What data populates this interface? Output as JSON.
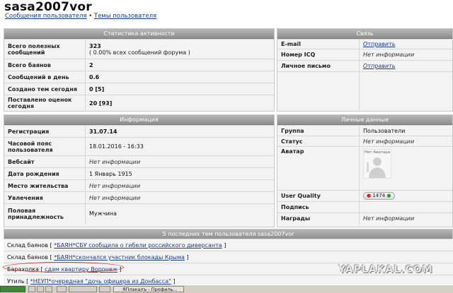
{
  "header": {
    "title": "sasa2007vor",
    "crumb1": "Сообщения пользователя",
    "crumb_sep": " • ",
    "crumb2": "Темы пользователя"
  },
  "stats": {
    "title": "Статистика активности",
    "rows": [
      {
        "k": "Всего полезных сообщений",
        "v": "323",
        "sub": "( 0.00% всех сообщений форума )"
      },
      {
        "k": "Всего баянов",
        "v": "2"
      },
      {
        "k": "Сообщений в день",
        "v": "0.6"
      },
      {
        "k": "Создано тем сегодня",
        "v": "0 [5]"
      },
      {
        "k": "Поставлено оценок сегодня",
        "v": "20 [93]"
      }
    ]
  },
  "contact": {
    "title": "Связь",
    "rows": [
      {
        "k": "E-mail",
        "v": "Отправить"
      },
      {
        "k": "Номер ICQ",
        "v": "Нет информации"
      },
      {
        "k": "Личное письмо",
        "v": "Отправить"
      }
    ]
  },
  "info": {
    "title": "Информация",
    "rows": [
      {
        "k": "Регистрация",
        "v": "31.07.14"
      },
      {
        "k": "Часовой пояс пользователя",
        "v": "18.01.2016 - 16:33"
      },
      {
        "k": "Вебсайт",
        "v": "Нет информации"
      },
      {
        "k": "Дата рождения",
        "v": "1 Январь 1915"
      },
      {
        "k": "Место жительства",
        "v": "Нет информации"
      },
      {
        "k": "Увлечения",
        "v": "Нет информации"
      },
      {
        "k": "Половая принадлежность",
        "v": "Мужчина"
      }
    ]
  },
  "personal": {
    "title": "Личные данные",
    "rows": [
      {
        "k": "Группа",
        "v": "Пользователи"
      },
      {
        "k": "Статус",
        "v": "Нет информации"
      },
      {
        "k": "Аватар",
        "v": "Нет Аватара"
      },
      {
        "k": "User Quality",
        "v": "1474"
      },
      {
        "k": "Подпись",
        "v": ""
      },
      {
        "k": "Награды",
        "v": "Нет информации"
      }
    ]
  },
  "topics": {
    "title": "5 последних тем пользователя sasa2007vor",
    "rows": [
      {
        "section": "Склад баянов",
        "open": " [ ",
        "topic": "*БАЯН*СБУ сообщила о гибели российского диверсанта",
        "close": " ]"
      },
      {
        "section": "Склад баянов",
        "open": " [ ",
        "topic": "*БАЯН*скончался участник блокады Крыма",
        "close": " ]"
      },
      {
        "section": "Барахолка",
        "open": " [ ",
        "topic": "сдам квартиру Воронеж",
        "close": " ]"
      },
      {
        "section": "Утиль",
        "open": " [ ",
        "topic": "*НЕУП*очередная \"дочь офицера из Донбасса\"",
        "close": " ]"
      }
    ]
  },
  "watermark": "YAPLAKAL.COM",
  "taskbar": {
    "item1": "ЯПлакалъ - Профиль..."
  },
  "colors": {
    "link": "#1a3d8f",
    "header_bg": "#9a9a9a",
    "highlight": "#dd3333"
  }
}
